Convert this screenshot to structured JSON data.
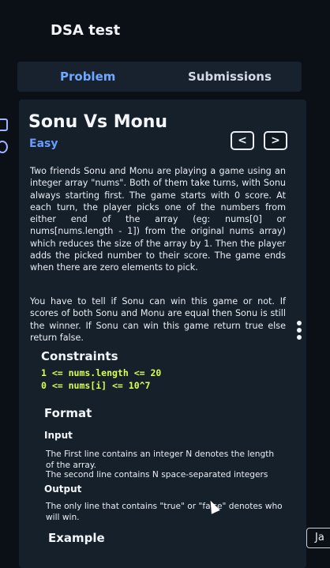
{
  "app": {
    "title": "DSA test"
  },
  "tabs": {
    "problem": "Problem",
    "submissions": "Submissions"
  },
  "problem": {
    "title": "Sonu Vs Monu",
    "difficulty": "Easy",
    "nav": {
      "prev": "<",
      "next": ">"
    },
    "description_1": "Two friends Sonu and Monu are playing a game using an integer array \"nums\". Both of them take turns, with Sonu always starting first. The game starts with 0 score. At each turn, the player picks one of the numbers from either end of the array (eg: nums[0] or nums[nums.length - 1]) from the original nums array) which reduces the size of the array by 1. Then the player adds the picked number to their score. The game ends when there are zero elements to pick.",
    "description_2": "You have to tell if Sonu can win this game or not. If scores of both Sonu and Monu are equal then Sonu is still the winner. If Sonu can win this game return true else return false."
  },
  "constraints": {
    "heading": "Constraints",
    "line1": "1 <= nums.length <= 20",
    "line2": "0 <= nums[i] <= 10^7"
  },
  "format": {
    "heading": "Format",
    "input_heading": "Input",
    "input_line1": "The First line contains an integer N denotes the length of the array.",
    "input_line2": "The second line contains N space-separated integers",
    "output_heading": "Output",
    "output_text": "The only line that contains \"true\" or \"false\" denotes who will win."
  },
  "example": {
    "heading": "Example"
  },
  "language_button": {
    "label": "Ja"
  }
}
